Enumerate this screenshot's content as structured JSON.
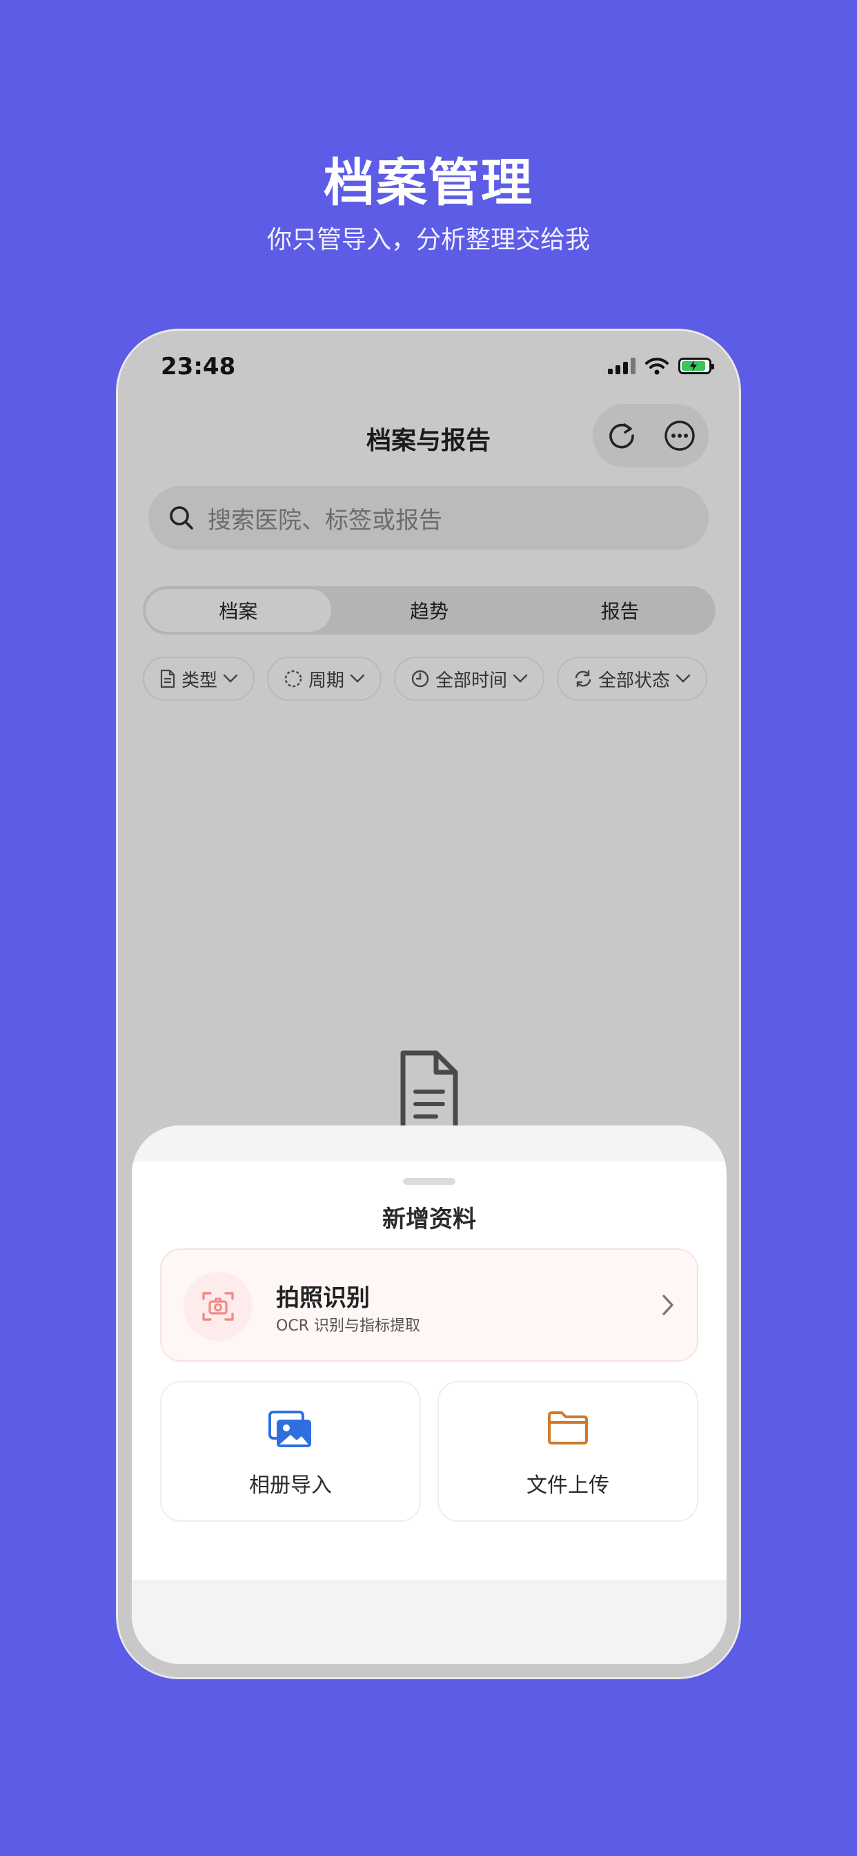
{
  "hero": {
    "title": "档案管理",
    "subtitle": "你只管导入，分析整理交给我"
  },
  "status_bar": {
    "time": "23:48"
  },
  "nav": {
    "title": "档案与报告",
    "actions": [
      "refresh-icon",
      "more-icon"
    ]
  },
  "search": {
    "placeholder": "搜索医院、标签或报告"
  },
  "tabs": [
    {
      "label": "档案",
      "active": true
    },
    {
      "label": "趋势",
      "active": false
    },
    {
      "label": "报告",
      "active": false
    }
  ],
  "filters": [
    {
      "label": "类型",
      "icon": "document-icon"
    },
    {
      "label": "周期",
      "icon": "dashed-circle-icon"
    },
    {
      "label": "全部时间",
      "icon": "clock-icon"
    },
    {
      "label": "全部状态",
      "icon": "sync-icon"
    }
  ],
  "sheet": {
    "title": "新增资料",
    "ocr": {
      "title": "拍照识别",
      "subtitle": "OCR 识别与指标提取"
    },
    "options": [
      {
        "label": "相册导入",
        "icon": "gallery-icon",
        "color": "#2f6fe0"
      },
      {
        "label": "文件上传",
        "icon": "folder-icon",
        "color": "#d27a2a"
      }
    ]
  },
  "colors": {
    "background": "#5d5ce6",
    "ocr_accent": "#f08a86",
    "battery": "#3cc55a"
  }
}
